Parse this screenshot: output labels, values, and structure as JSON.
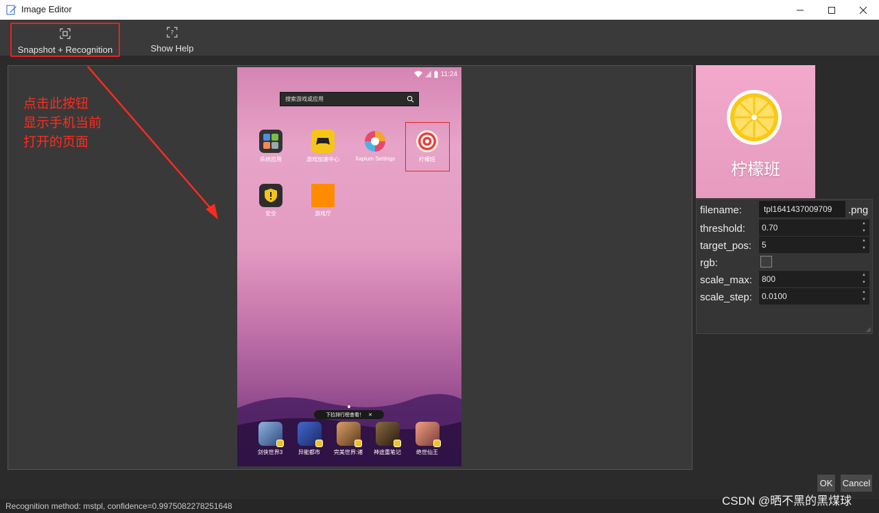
{
  "window": {
    "title": "Image Editor",
    "controls": {
      "minimize": "—",
      "maximize": "☐",
      "close": "✕"
    }
  },
  "toolbar": {
    "snapshot_label": "Snapshot + Recognition",
    "help_label": "Show Help",
    "snapshot_icon": "target-frame-icon",
    "help_icon": "question-frame-icon",
    "highlight_color": "#e8231f"
  },
  "annotation": {
    "lines": [
      "点击此按钮",
      "显示手机当前",
      "打开的页面"
    ],
    "color": "#ff2b1f"
  },
  "phone": {
    "time": "11:24",
    "search_placeholder": "搜索游戏或应用",
    "apps_row1": [
      {
        "label": "系统应用",
        "color": "#3b3b3b"
      },
      {
        "label": "游戏加速中心",
        "color": "#f5c518"
      },
      {
        "label": "Xapium Settings",
        "color": "#e64a6a"
      },
      {
        "label": "柠檬班",
        "color": "#f2f2f2"
      }
    ],
    "apps_row2": [
      {
        "label": "安全",
        "color": "#2d2d2d"
      },
      {
        "label": "游戏厅",
        "color": "#ff8c00"
      }
    ],
    "notice": "下拉排行榜查看！",
    "dock": [
      {
        "label": "剑侠世界3",
        "color": "#5577aa"
      },
      {
        "label": "异能都市",
        "color": "#3355aa"
      },
      {
        "label": "完美世界:诸",
        "color": "#aa7744"
      },
      {
        "label": "神途重笔记",
        "color": "#664422"
      },
      {
        "label": "绝世仙王",
        "color": "#cc5544"
      }
    ]
  },
  "preview": {
    "title": "柠檬班"
  },
  "props": {
    "filename_label": "filename:",
    "filename_value": "tpl1641437009709",
    "filename_suffix": ".png",
    "threshold_label": "threshold:",
    "threshold_value": "0.70",
    "target_pos_label": "target_pos:",
    "target_pos_value": "5",
    "rgb_label": "rgb:",
    "rgb_checked": false,
    "scale_max_label": "scale_max:",
    "scale_max_value": "800",
    "scale_step_label": "scale_step:",
    "scale_step_value": "0.0100"
  },
  "buttons": {
    "ok": "OK",
    "cancel": "Cancel"
  },
  "statusbar": {
    "text": "Recognition method: mstpl, confidence=0.9975082278251648"
  },
  "watermark": "CSDN @晒不黑的黑煤球"
}
